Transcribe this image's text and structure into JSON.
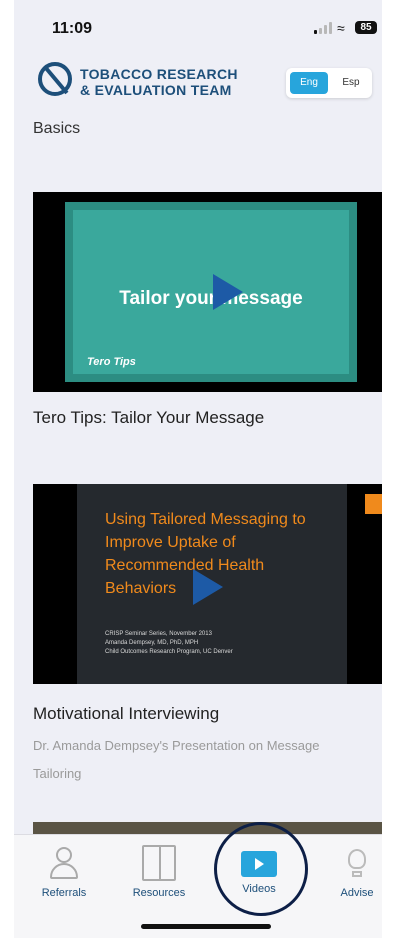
{
  "status": {
    "time": "11:09",
    "battery": "85"
  },
  "header": {
    "logo_line1": "TOBACCO RESEARCH",
    "logo_line2": "& EVALUATION TEAM",
    "lang_eng": "Eng",
    "lang_esp": "Esp",
    "active_lang": "Eng"
  },
  "section": {
    "title": "Basics"
  },
  "videos": [
    {
      "thumb_text": "Tailor your message",
      "thumb_tag": "Tero Tips",
      "title": "Tero Tips: Tailor Your Message"
    },
    {
      "thumb_heading": "Using Tailored Messaging to Improve Uptake of Recommended Health Behaviors",
      "thumb_meta": "CRISP Seminar Series, November 2013\nAmanda Dempsey, MD, PhD, MPH\nChild Outcomes Research Program, UC Denver",
      "title": "Motivational Interviewing",
      "subtitle": "Dr. Amanda Dempsey's Presentation on Message Tailoring"
    }
  ],
  "tabs": [
    {
      "label": "Referrals",
      "icon": "person-add-icon"
    },
    {
      "label": "Resources",
      "icon": "book-icon"
    },
    {
      "label": "Videos",
      "icon": "video-icon",
      "active": true
    },
    {
      "label": "Advise",
      "icon": "lightbulb-icon"
    }
  ],
  "colors": {
    "brand": "#1d4f7a",
    "accent": "#27a5dc",
    "highlight_circle": "#0d1f47"
  }
}
